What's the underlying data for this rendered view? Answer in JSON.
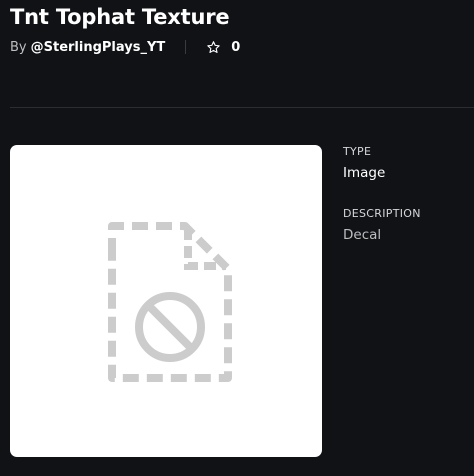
{
  "asset": {
    "title": "Tnt Tophat Texture",
    "by_label": "By",
    "creator": "@SterlingPlays_YT",
    "favorites_count": "0"
  },
  "thumbnail": {
    "icon": "missing-image-icon"
  },
  "details": {
    "type_label": "TYPE",
    "type_value": "Image",
    "description_label": "DESCRIPTION",
    "description_value": "Decal"
  },
  "colors": {
    "background": "#111216",
    "text_primary": "#ffffff",
    "text_secondary": "#bdbebe",
    "divider": "#2b2d31",
    "thumbnail_bg": "#ffffff",
    "placeholder_icon": "#cccccc"
  },
  "icons": {
    "favorite": "star-outline-icon"
  }
}
